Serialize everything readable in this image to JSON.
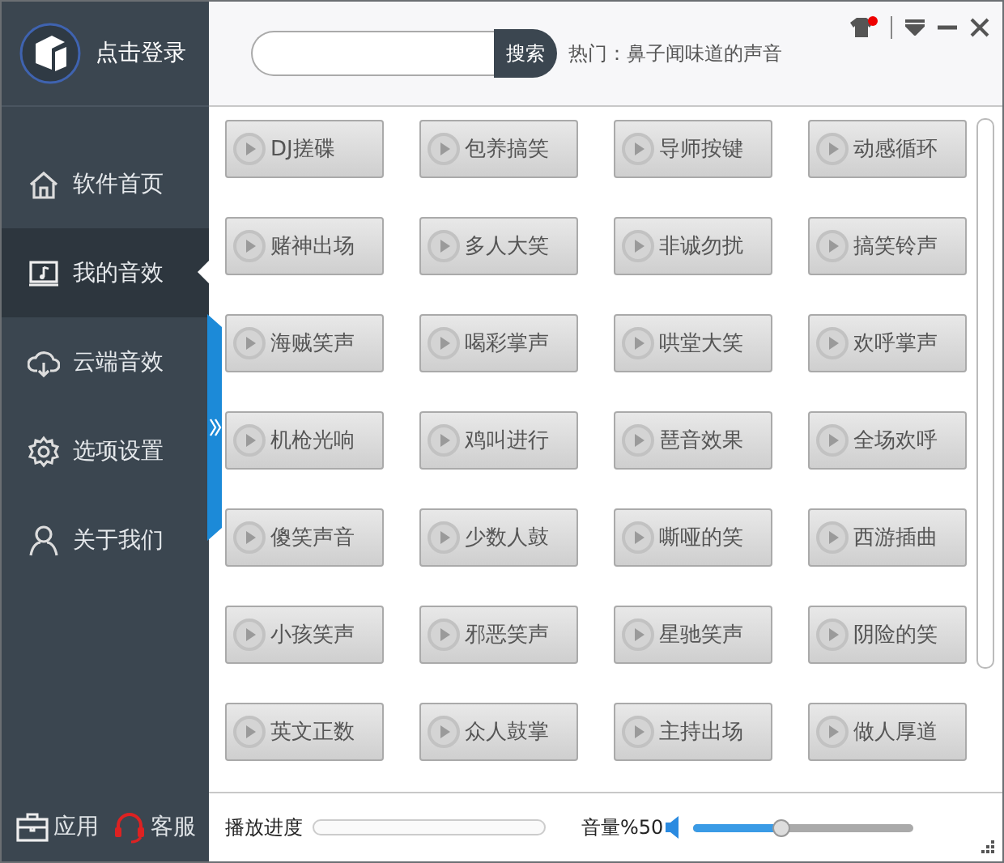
{
  "sidebar": {
    "login": "点击登录",
    "items": [
      {
        "label": "软件首页",
        "selected": false
      },
      {
        "label": "我的音效",
        "selected": true
      },
      {
        "label": "云端音效",
        "selected": false
      },
      {
        "label": "选项设置",
        "selected": false
      },
      {
        "label": "关于我们",
        "selected": false
      }
    ],
    "bottom": [
      {
        "label": "应用"
      },
      {
        "label": "客服"
      }
    ]
  },
  "header": {
    "search_button": "搜索",
    "hot_label": "热门：",
    "hot_text": "鼻子闻味道的声音"
  },
  "sounds": [
    "DJ搓碟",
    "包养搞笑",
    "导师按键",
    "动感循环",
    "赌神出场",
    "多人大笑",
    "非诚勿扰",
    "搞笑铃声",
    "海贼笑声",
    "喝彩掌声",
    "哄堂大笑",
    "欢呼掌声",
    "机枪光响",
    "鸡叫进行",
    "琶音效果",
    "全场欢呼",
    "傻笑声音",
    "少数人鼓",
    "嘶哑的笑",
    "西游插曲",
    "小孩笑声",
    "邪恶笑声",
    "星驰笑声",
    "阴险的笑",
    "英文正数",
    "众人鼓掌",
    "主持出场",
    "做人厚道"
  ],
  "footer": {
    "progress_label": "播放进度",
    "progress": {
      "level": 0
    },
    "volume_label": "音量%50",
    "volume": {
      "level": 0.4
    }
  }
}
